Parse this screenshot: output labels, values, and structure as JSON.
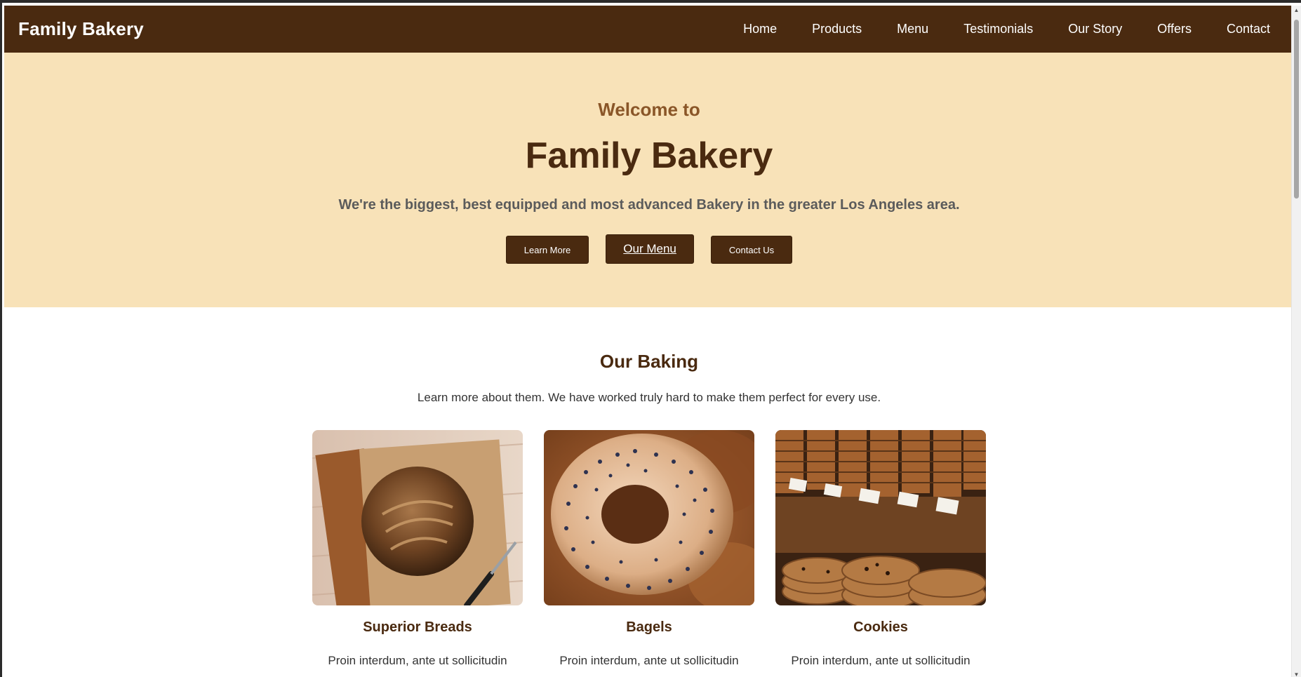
{
  "navbar": {
    "brand": "Family Bakery",
    "links": [
      "Home",
      "Products",
      "Menu",
      "Testimonials",
      "Our Story",
      "Offers",
      "Contact"
    ]
  },
  "hero": {
    "eyebrow": "Welcome to",
    "title": "Family Bakery",
    "subtitle": "We're the biggest, best equipped and most advanced Bakery in the greater Los Angeles area.",
    "buttons": {
      "learn_more": "Learn More",
      "our_menu": "Our Menu",
      "contact_us": "Contact Us"
    }
  },
  "baking": {
    "title": "Our Baking",
    "subtitle": "Learn more about them. We have worked truly hard to make them perfect for every use.",
    "cards": [
      {
        "title": "Superior Breads",
        "text": "Proin interdum, ante ut sollicitudin"
      },
      {
        "title": "Bagels",
        "text": "Proin interdum, ante ut sollicitudin"
      },
      {
        "title": "Cookies",
        "text": "Proin interdum, ante ut sollicitudin"
      }
    ]
  },
  "colors": {
    "brand_brown": "#4a2a10",
    "hero_bg": "#f8e2b8",
    "accent_brown": "#8a5628"
  }
}
